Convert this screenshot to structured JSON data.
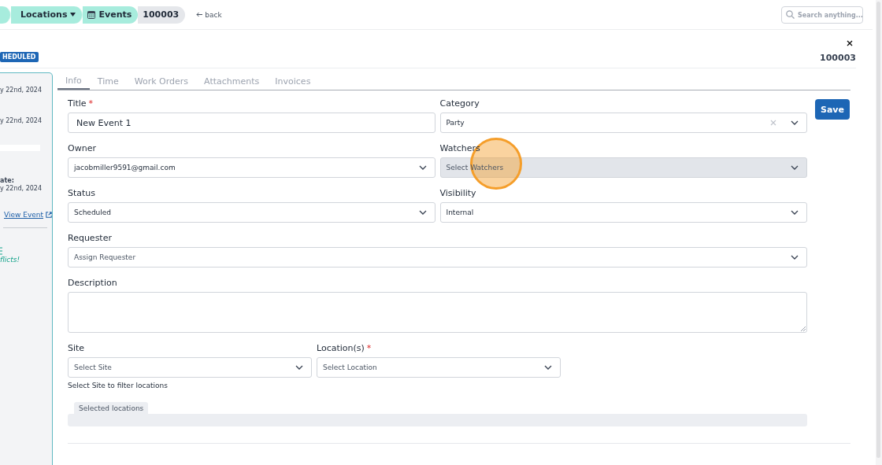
{
  "breadcrumb": [
    {
      "kind": "blank"
    },
    {
      "kind": "dropdown",
      "label": "Locations"
    },
    {
      "kind": "current",
      "label": "Events"
    },
    {
      "kind": "id",
      "label": "100003"
    }
  ],
  "back_link": "back",
  "search": {
    "placeholder": "Search anything..."
  },
  "status_badge": "HEDULED",
  "record_id": "100003",
  "sidebar": {
    "dates": [
      "y 22nd, 2024",
      "y 22nd, 2024"
    ],
    "date_label": "ate:",
    "date_value": "y 22nd, 2024",
    "link": "View Event",
    "note": "flicts!"
  },
  "tabs": [
    {
      "label": "Info",
      "selected": true
    },
    {
      "label": "Time",
      "selected": false
    },
    {
      "label": "Work Orders",
      "selected": false
    },
    {
      "label": "Attachments",
      "selected": false
    },
    {
      "label": "Invoices",
      "selected": false
    }
  ],
  "rows": [
    {
      "kind": "pair",
      "fields": [
        {
          "kind": "text",
          "label": "Title",
          "required_mark": "*",
          "value": "New Event 1"
        },
        {
          "kind": "select",
          "label": "Category",
          "value": "Party",
          "clearable": true,
          "disabled": false
        }
      ]
    },
    {
      "kind": "pair",
      "fields": [
        {
          "kind": "select",
          "label": "Owner",
          "value": "jacobmiller9591@gmail.com",
          "disabled": false
        },
        {
          "kind": "select",
          "label": "Watchers",
          "placeholder": "Select Watchers",
          "disabled": true
        }
      ]
    },
    {
      "kind": "pair",
      "fields": [
        {
          "kind": "select",
          "label": "Status",
          "value": "Scheduled",
          "disabled": false
        },
        {
          "kind": "select",
          "label": "Visibility",
          "value": "Internal",
          "disabled": false
        }
      ]
    },
    {
      "kind": "full",
      "fields": [
        {
          "kind": "select",
          "label": "Requester",
          "placeholder": "Assign Requester",
          "disabled": false
        }
      ]
    },
    {
      "kind": "full",
      "fields": [
        {
          "kind": "textarea",
          "label": "Description"
        }
      ]
    },
    {
      "kind": "narrow",
      "fields": [
        {
          "kind": "select",
          "label": "Site",
          "placeholder": "Select Site",
          "disabled": false
        },
        {
          "kind": "select",
          "label": "Location(s)",
          "required_mark": "*",
          "placeholder": "Select Location",
          "disabled": false
        }
      ]
    }
  ],
  "site_hint": "Select Site to filter locations",
  "selected_locations": "Selected locations",
  "save_button": "Save"
}
